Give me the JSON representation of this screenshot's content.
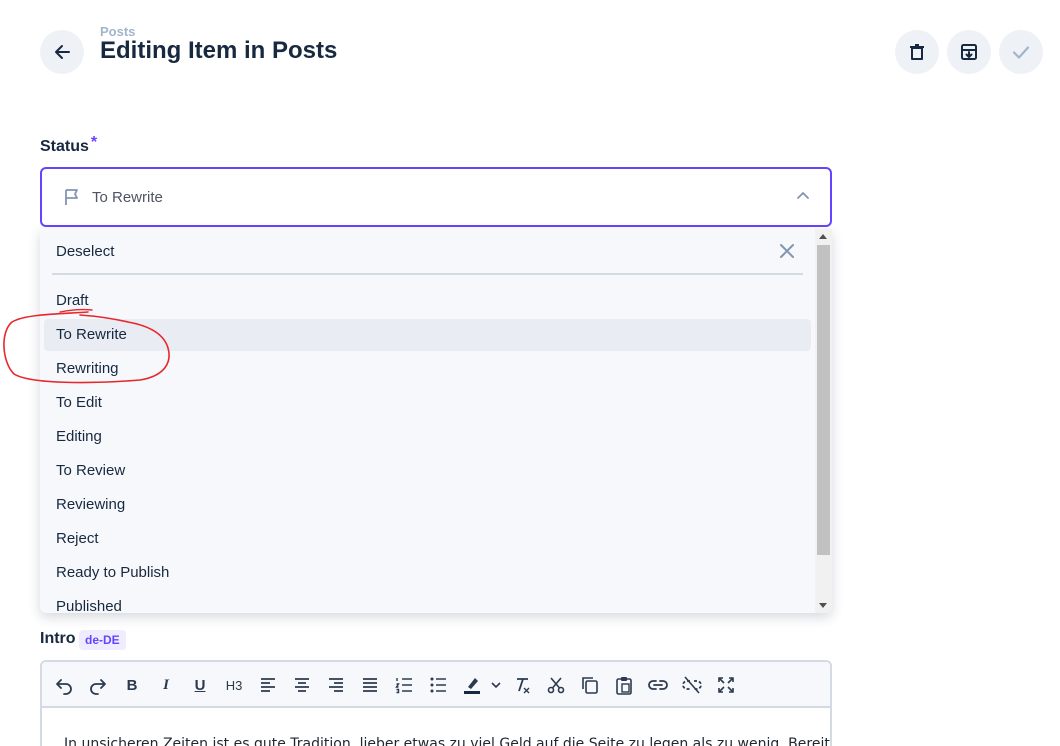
{
  "header": {
    "breadcrumb": "Posts",
    "title": "Editing Item in Posts"
  },
  "status_field": {
    "label": "Status",
    "required_mark": "*",
    "selected_value": "To Rewrite"
  },
  "dropdown": {
    "deselect_label": "Deselect",
    "options": [
      "Draft",
      "To Rewrite",
      "Rewriting",
      "To Edit",
      "Editing",
      "To Review",
      "Reviewing",
      "Reject",
      "Ready to Publish",
      "Published"
    ],
    "hovered_option": "To Rewrite"
  },
  "intro_field": {
    "label": "Intro",
    "language_badge": "de-DE",
    "toolbar": {
      "heading_label": "H3"
    },
    "content_preview": "In unsicheren Zeiten ist es gute Tradition, lieber etwas zu viel Geld auf die Seite zu legen als zu wenig. Bereits"
  },
  "colors": {
    "accent": "#6644ff",
    "text": "#172940",
    "annotation": "#e8262b"
  },
  "icons": [
    "arrow-left-icon",
    "trash-icon",
    "archive-icon",
    "check-icon",
    "flag-icon",
    "chevron-up-icon",
    "close-icon"
  ]
}
